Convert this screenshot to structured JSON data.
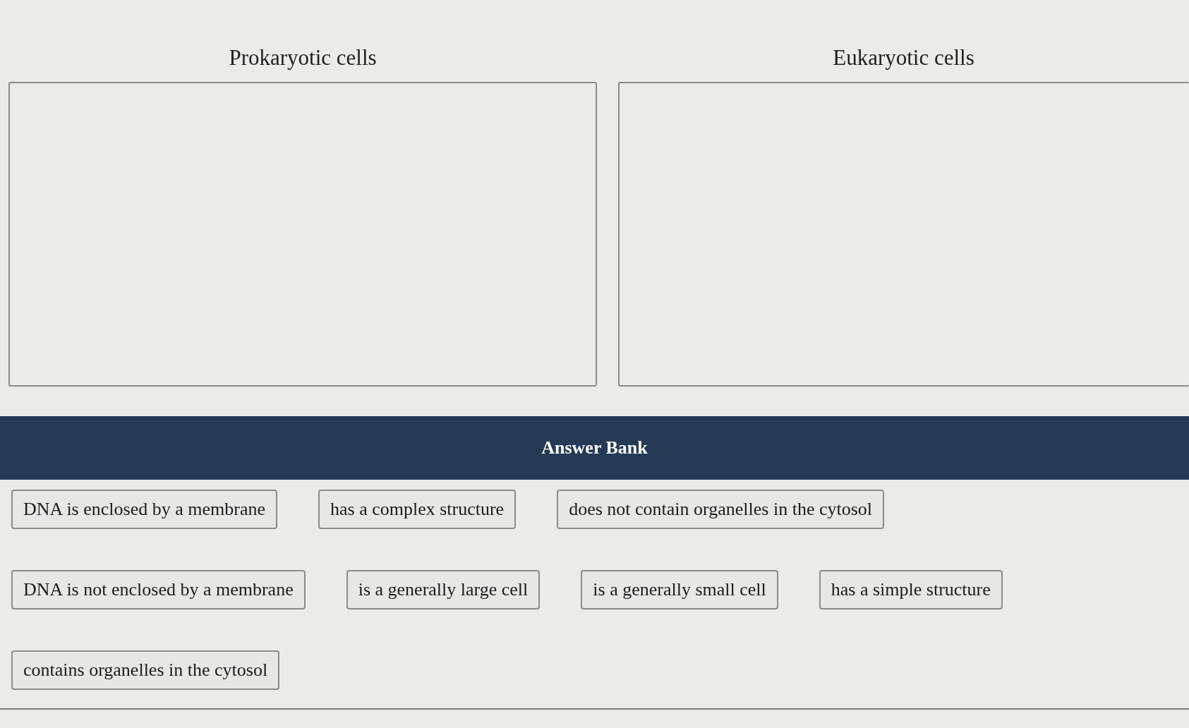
{
  "zones": [
    {
      "title": "Prokaryotic cells"
    },
    {
      "title": "Eukaryotic cells"
    }
  ],
  "answer_bank": {
    "title": "Answer Bank",
    "rows": [
      {
        "items": [
          "DNA is enclosed by a membrane",
          "has a complex structure",
          "does not contain organelles in the cytosol"
        ]
      },
      {
        "items": [
          "DNA is not enclosed by a membrane",
          "is a generally large cell",
          "is a generally small cell",
          "has a simple structure"
        ]
      },
      {
        "items": [
          "contains organelles in the cytosol"
        ]
      }
    ]
  }
}
